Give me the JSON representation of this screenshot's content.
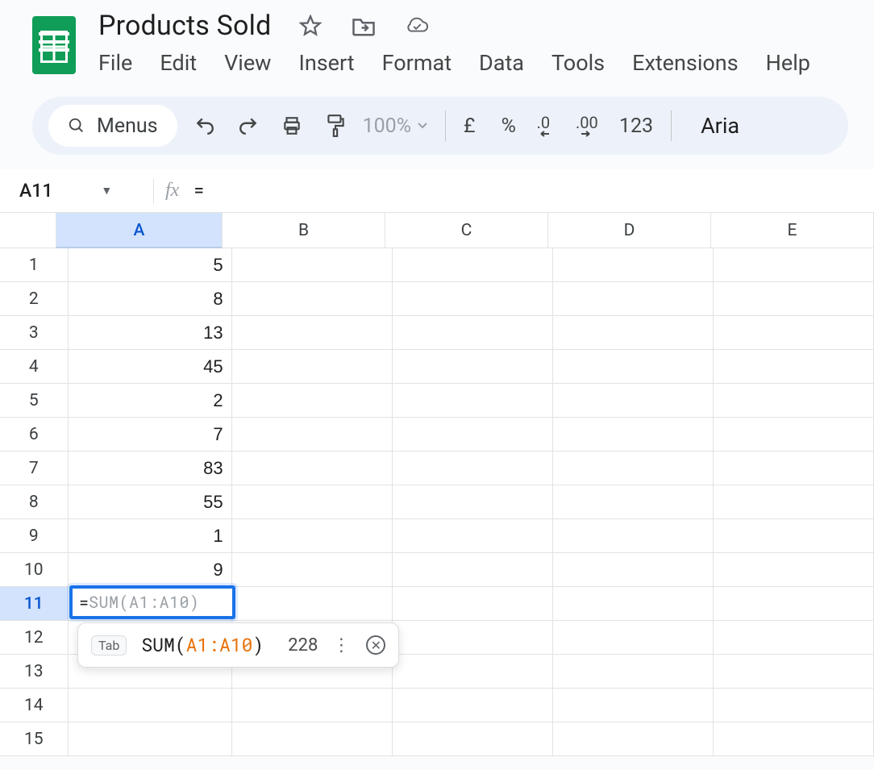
{
  "doc": {
    "title": "Products Sold"
  },
  "menu": {
    "items": [
      "File",
      "Edit",
      "View",
      "Insert",
      "Format",
      "Data",
      "Tools",
      "Extensions",
      "Help"
    ]
  },
  "toolbar": {
    "menus_label": "Menus",
    "zoom": "100%",
    "currency": "£",
    "percent": "%",
    "dec_dec": ".0",
    "inc_dec": ".00",
    "numfmt": "123",
    "font": "Aria"
  },
  "namebox": {
    "ref": "A11"
  },
  "formula_bar": {
    "value": "="
  },
  "columns": [
    "A",
    "B",
    "C",
    "D",
    "E"
  ],
  "selected_column": "A",
  "rows": [
    {
      "n": 1,
      "A": "5"
    },
    {
      "n": 2,
      "A": "8"
    },
    {
      "n": 3,
      "A": "13"
    },
    {
      "n": 4,
      "A": "45"
    },
    {
      "n": 5,
      "A": "2"
    },
    {
      "n": 6,
      "A": "7"
    },
    {
      "n": 7,
      "A": "83"
    },
    {
      "n": 8,
      "A": "55"
    },
    {
      "n": 9,
      "A": "1"
    },
    {
      "n": 10,
      "A": "9"
    },
    {
      "n": 11,
      "A": ""
    },
    {
      "n": 12,
      "A": ""
    },
    {
      "n": 13,
      "A": ""
    },
    {
      "n": 14,
      "A": ""
    },
    {
      "n": 15,
      "A": ""
    }
  ],
  "selected_row": 11,
  "active_cell": {
    "typed": "=",
    "ghost": "SUM(A1:A10)"
  },
  "suggestion": {
    "key_hint": "Tab",
    "func": "SUM",
    "open": "(",
    "range": "A1:A10",
    "close": ")",
    "result": "228"
  }
}
